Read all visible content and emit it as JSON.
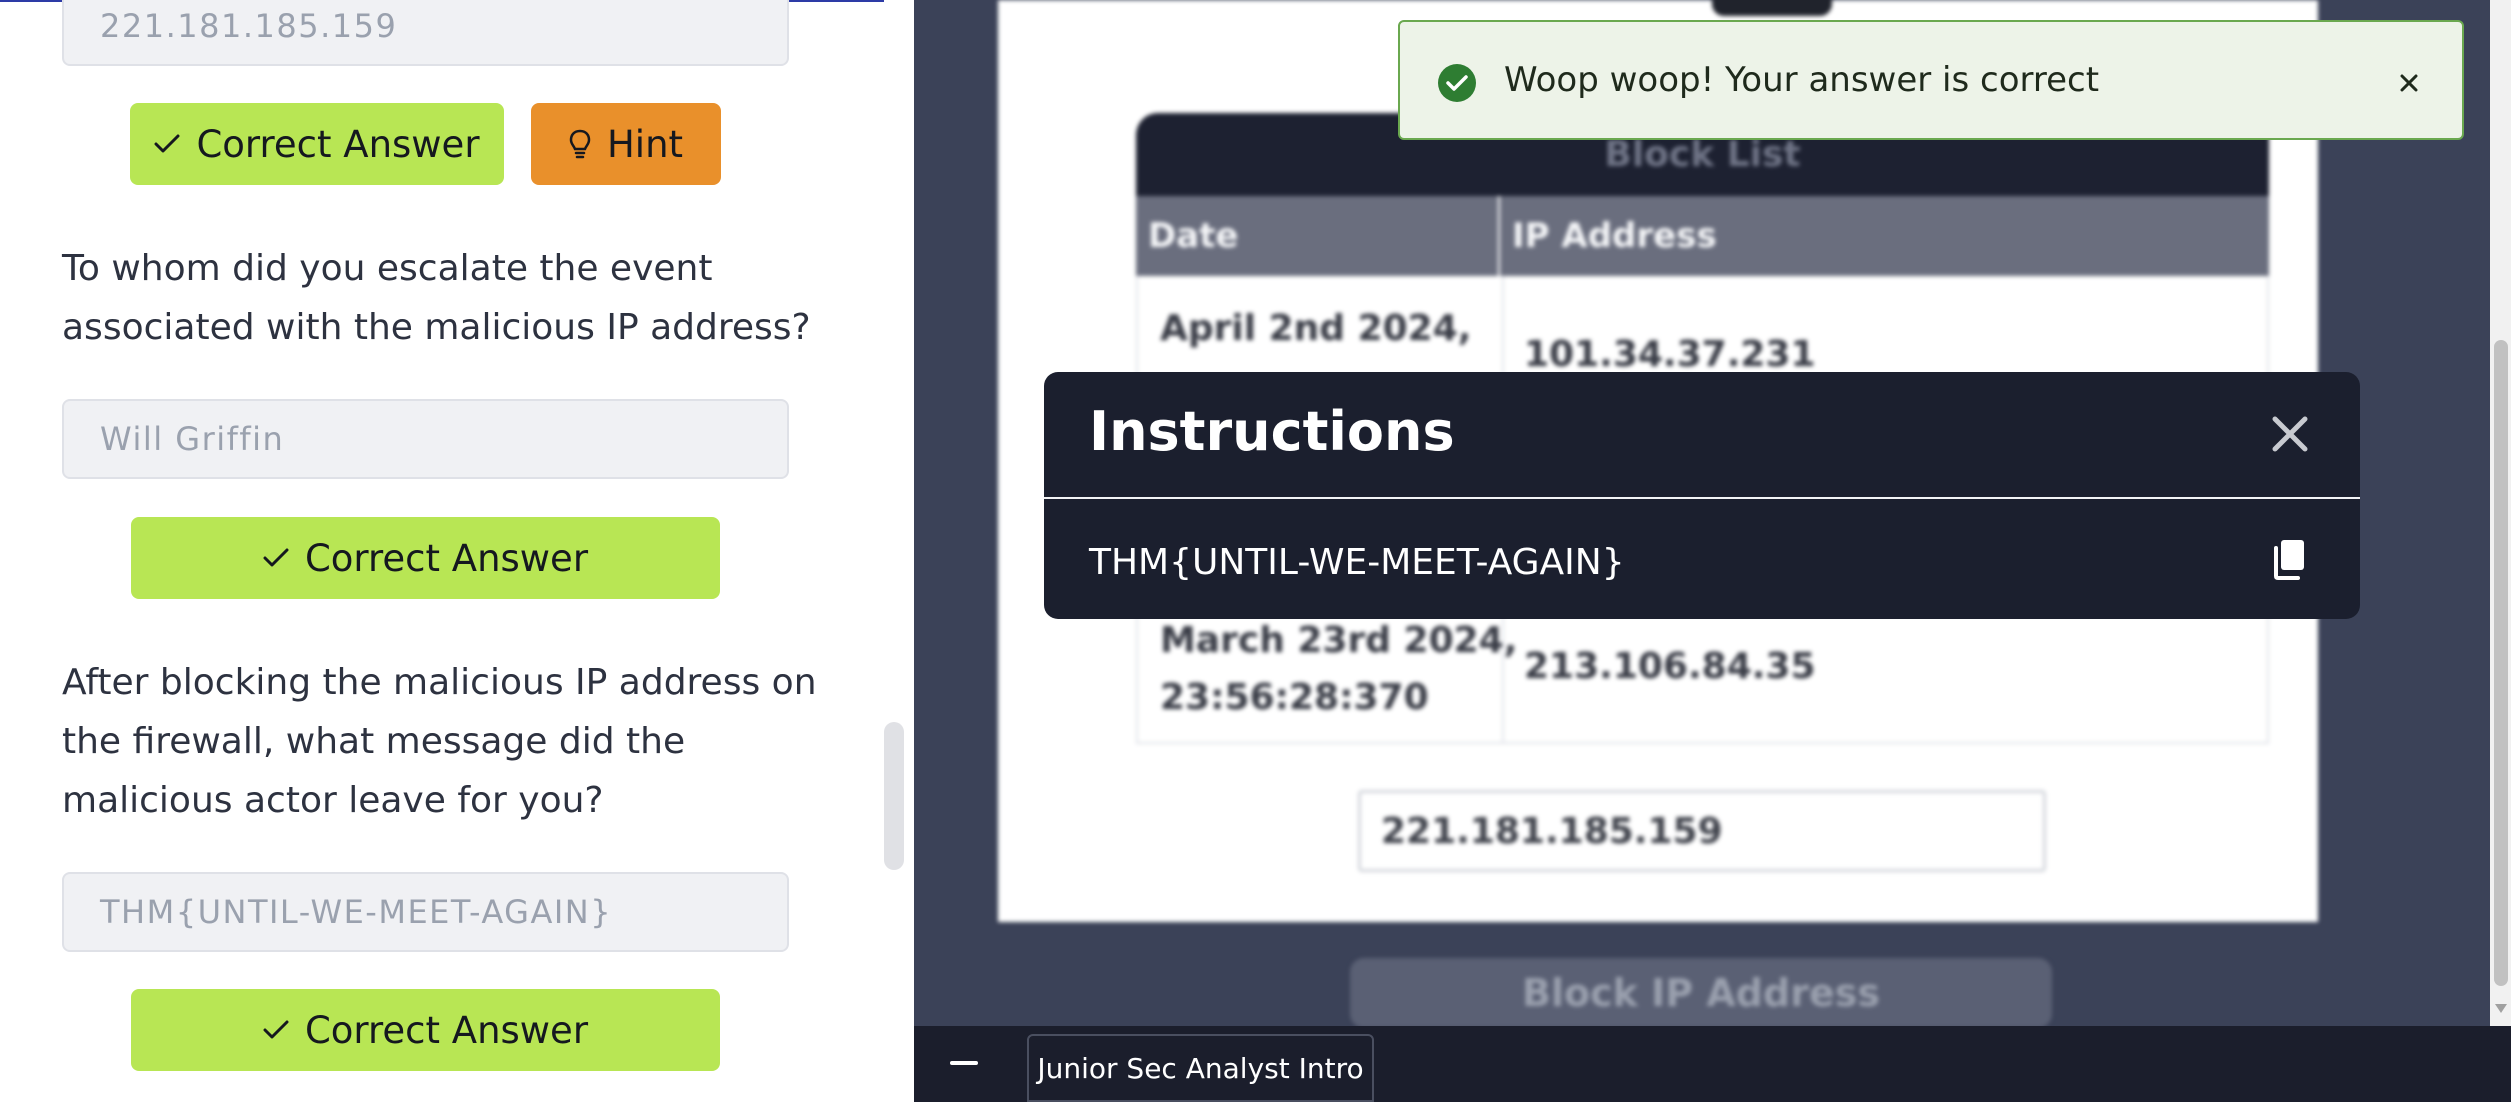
{
  "tasks": {
    "answer_1": "221.181.185.159",
    "correct_label": "Correct Answer",
    "hint_label": "Hint",
    "question_2": "To whom did you escalate the event associated with the malicious IP address?",
    "answer_2": "Will Griffin",
    "question_3": "After blocking the malicious IP address on the firewall, what message did the malicious actor leave for you?",
    "answer_3": "THM{UNTIL-WE-MEET-AGAIN}"
  },
  "toast": {
    "message": "Woop woop! Your answer is correct"
  },
  "modal": {
    "title": "Instructions",
    "flag": "THM{UNTIL-WE-MEET-AGAIN}"
  },
  "block_list": {
    "title": "Block List",
    "col_date": "Date",
    "col_ip": "IP Address",
    "row1_date": "April 2nd 2024,",
    "row1_ip": "101.34.37.231",
    "row2_date_a": "March 23rd 2024,",
    "row2_date_b": "23:56:28:370",
    "row2_ip": "213.106.84.35",
    "input_value": "221.181.185.159",
    "block_button": "Block IP Address"
  },
  "bottom_bar": {
    "tab_label": "Junior Sec Analyst Intro"
  },
  "colors": {
    "correct_green": "#b8e654",
    "hint_orange": "#e9902b",
    "modal_bg": "#1b1f2e",
    "toast_border": "#6aa84f"
  }
}
